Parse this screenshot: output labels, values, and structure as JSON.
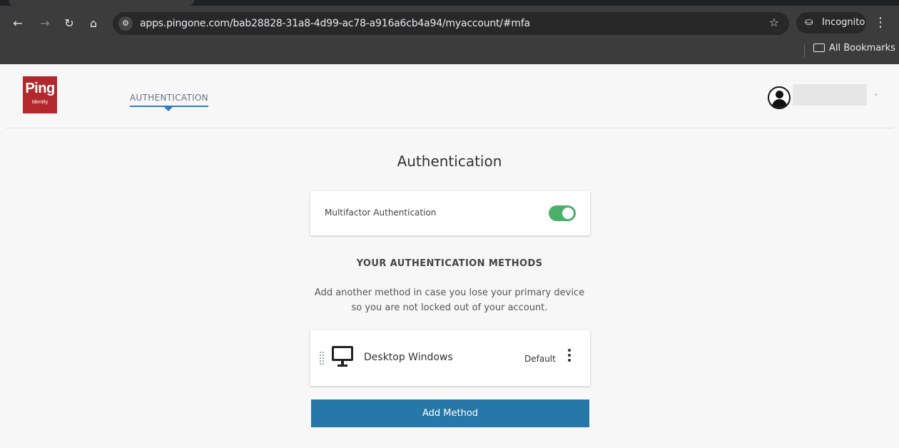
{
  "browser": {
    "url": "apps.pingone.com/bab28828-31a8-4d99-ac78-a916a6cb4a94/myaccount/#mfa",
    "incognito_label": "Incognito",
    "bookmarks_label": "All Bookmarks",
    "icons": [
      "back-arrow-icon",
      "forward-arrow-icon",
      "reload-icon",
      "home-icon",
      "site-info-icon",
      "bookmark-star-icon",
      "incognito-icon",
      "kebab-menu-icon",
      "folder-icon"
    ]
  },
  "header": {
    "logo_text": "Ping",
    "logo_sub": "Identity",
    "nav_tab": "AUTHENTICATION",
    "accent_color": "#2f7fbf",
    "brand_color": "#b3282d"
  },
  "main": {
    "title": "Authentication",
    "mfa": {
      "label": "Multifactor Authentication",
      "enabled": true,
      "toggle_color": "#4cae6b"
    },
    "methods_heading": "YOUR AUTHENTICATION METHODS",
    "helper_line1": "Add another method in case you lose your primary device",
    "helper_line2": "so you are not locked out of your account.",
    "methods": [
      {
        "name": "Desktop Windows",
        "status": "Default",
        "icon": "desktop-monitor-icon"
      }
    ],
    "add_button": "Add Method",
    "add_button_color": "#2778a8"
  }
}
